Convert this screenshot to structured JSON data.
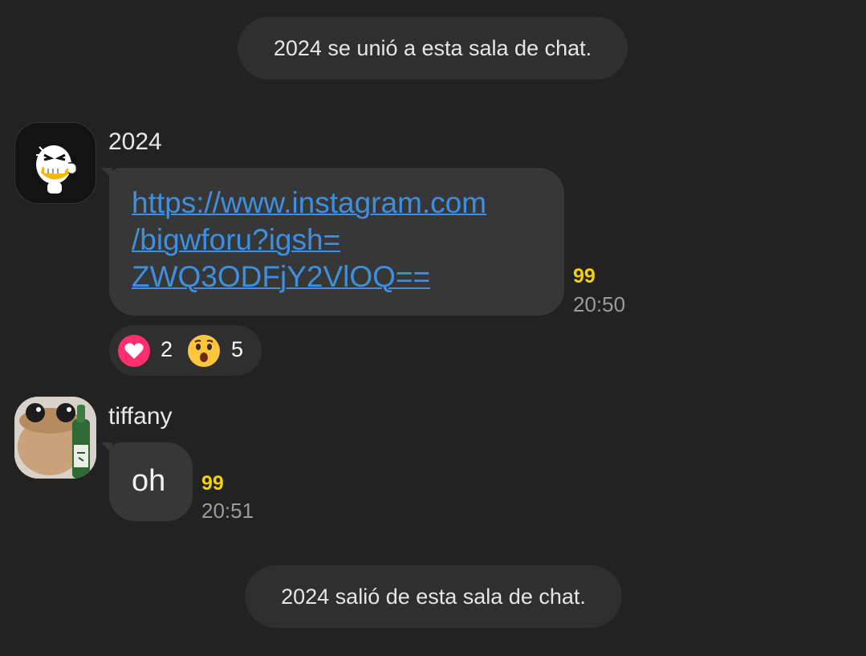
{
  "system_messages": {
    "joined": "2024 se unió a esta sala de chat.",
    "left": "2024 salió de esta sala de chat."
  },
  "messages": [
    {
      "sender": "2024",
      "avatar_icon": "laughing-duck-sticker-avatar",
      "link_lines": [
        "https://www.instagram.com",
        "/bigwforu?igsh=",
        "ZWQ3ODFjY2VlOQ=="
      ],
      "unread_count": "99",
      "time": "20:50",
      "reactions": [
        {
          "icon": "heart-icon",
          "count": "2"
        },
        {
          "icon": "surprised-face-icon",
          "count": "5"
        }
      ]
    },
    {
      "sender": "tiffany",
      "avatar_icon": "plush-creature-with-bottle-avatar",
      "text": "oh",
      "unread_count": "99",
      "time": "20:51"
    }
  ],
  "colors": {
    "background": "#222222",
    "bubble": "#373737",
    "link": "#3e8fe0",
    "unread": "#f7d100",
    "heart": "#ff2e6d",
    "wow": "#ffc53d"
  }
}
